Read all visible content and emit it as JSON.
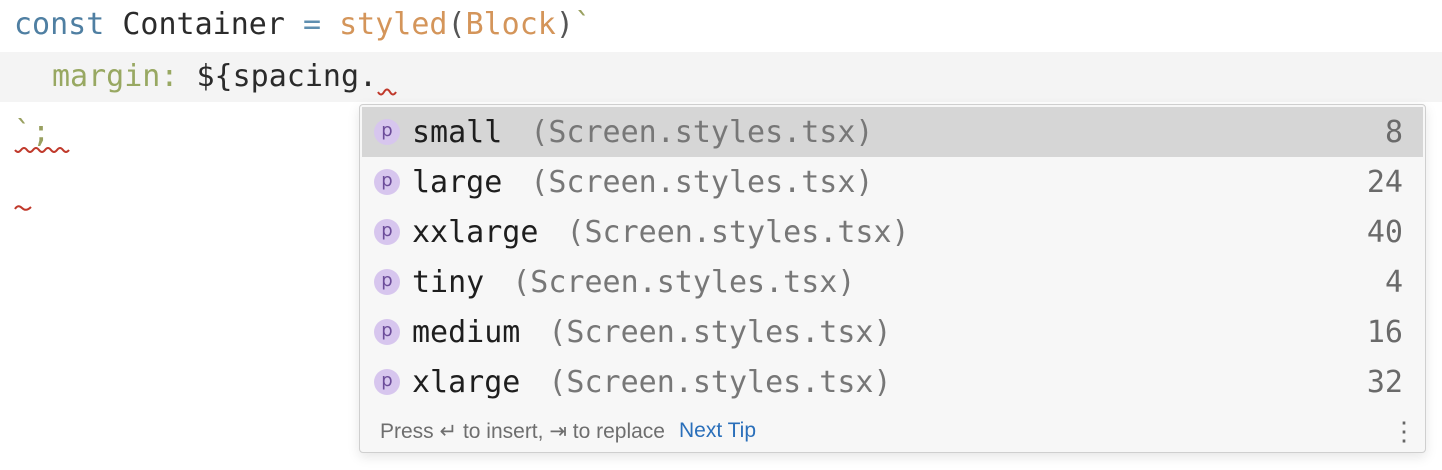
{
  "editor": {
    "line1": {
      "keyword": "const",
      "identifier": "Container",
      "operator": "=",
      "function": "styled",
      "open_paren": "(",
      "argument": "Block",
      "close_paren": ")",
      "backtick": "`"
    },
    "line2": {
      "property": "margin:",
      "expression": "${spacing."
    },
    "line3": {
      "text": "`;"
    }
  },
  "completion": {
    "items": [
      {
        "kind_icon": "p",
        "name": "small",
        "source": "(Screen.styles.tsx)",
        "value": "8"
      },
      {
        "kind_icon": "p",
        "name": "large",
        "source": "(Screen.styles.tsx)",
        "value": "24"
      },
      {
        "kind_icon": "p",
        "name": "xxlarge",
        "source": "(Screen.styles.tsx)",
        "value": "40"
      },
      {
        "kind_icon": "p",
        "name": "tiny",
        "source": "(Screen.styles.tsx)",
        "value": "4"
      },
      {
        "kind_icon": "p",
        "name": "medium",
        "source": "(Screen.styles.tsx)",
        "value": "16"
      },
      {
        "kind_icon": "p",
        "name": "xlarge",
        "source": "(Screen.styles.tsx)",
        "value": "32"
      }
    ],
    "footer": {
      "hint": "Press ↵ to insert, ⇥ to replace",
      "next_tip": "Next Tip",
      "more_icon": "⋮"
    }
  },
  "colors": {
    "keyword": "#4f7fa2",
    "function": "#d4955a",
    "property": "#98a862",
    "error_underline": "#c0392b",
    "link": "#2a6fba",
    "icon_badge": "#d7c6ee"
  }
}
